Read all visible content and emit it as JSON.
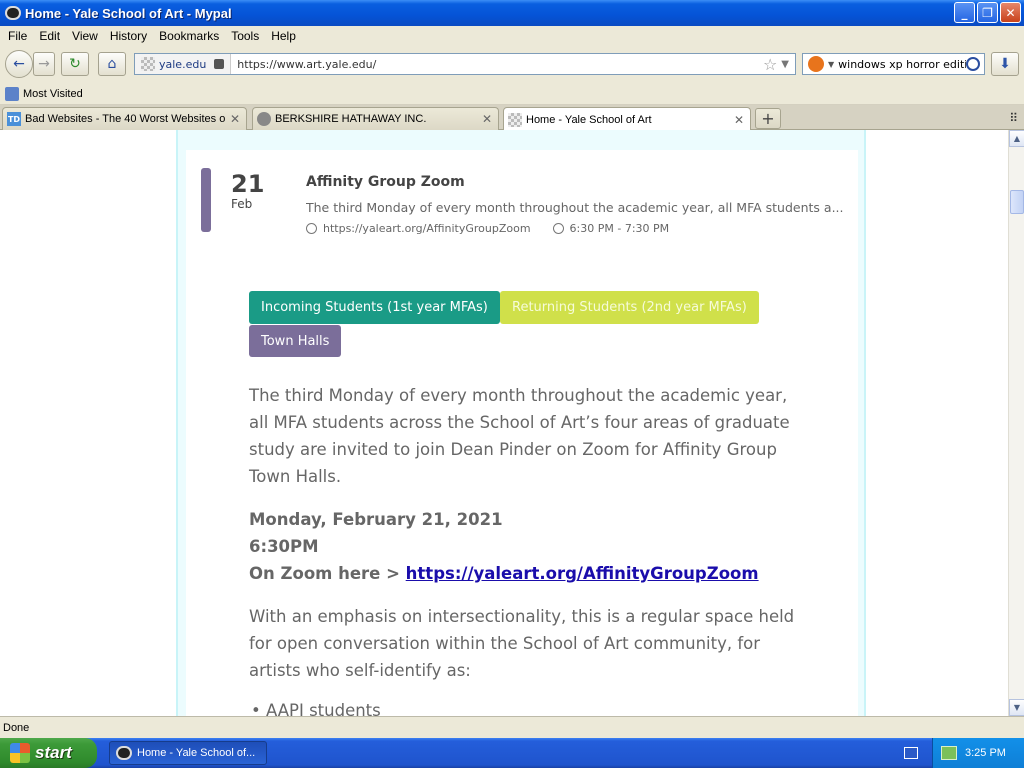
{
  "window": {
    "title": "Home - Yale School of Art - Mypal",
    "buttons": {
      "minimize": "_",
      "maximize": "❐",
      "close": "✕"
    }
  },
  "menu": [
    "File",
    "Edit",
    "View",
    "History",
    "Bookmarks",
    "Tools",
    "Help"
  ],
  "nav": {
    "site_identity": "yale.edu",
    "url": "https://www.art.yale.edu/",
    "search_value": "windows xp horror edition"
  },
  "bookmarks": {
    "most_visited": "Most Visited"
  },
  "tabs": [
    {
      "label": "Bad Websites - The 40 Worst Websites o...",
      "favicon": "TD",
      "active": false
    },
    {
      "label": "BERKSHIRE HATHAWAY INC.",
      "favicon": "",
      "active": false
    },
    {
      "label": "Home - Yale School of Art",
      "favicon": "",
      "active": true
    }
  ],
  "event": {
    "day": "21",
    "month": "Feb",
    "title": "Affinity Group Zoom",
    "description": "The third Monday of every month throughout the academic year, all MFA students a...",
    "link": "https://yaleart.org/AffinityGroupZoom",
    "time": "6:30 PM - 7:30 PM"
  },
  "tags": {
    "incoming": "Incoming Students (1st year MFAs)",
    "returning": "Returning Students (2nd year MFAs)",
    "town_halls": "Town Halls"
  },
  "body": {
    "para1": "The third Monday of every month throughout the academic year, all MFA students across the School of Art’s four areas of graduate study are invited to join Dean Pinder on Zoom for Affinity Group Town Halls.",
    "date_line": "Monday, February 21, 2021",
    "time_line": "6:30PM",
    "zoom_prefix": "On Zoom here > ",
    "zoom_link": "https://yaleart.org/AffinityGroupZoom",
    "para2": "With an emphasis on intersectionality, this is a regular space held for open conversation within the School of Art community, for artists who self-identify as:",
    "bullet1": "• AAPI students"
  },
  "status": "Done",
  "taskbar": {
    "start": "start",
    "task_label": "Home - Yale School of...",
    "clock": "3:25 PM"
  }
}
